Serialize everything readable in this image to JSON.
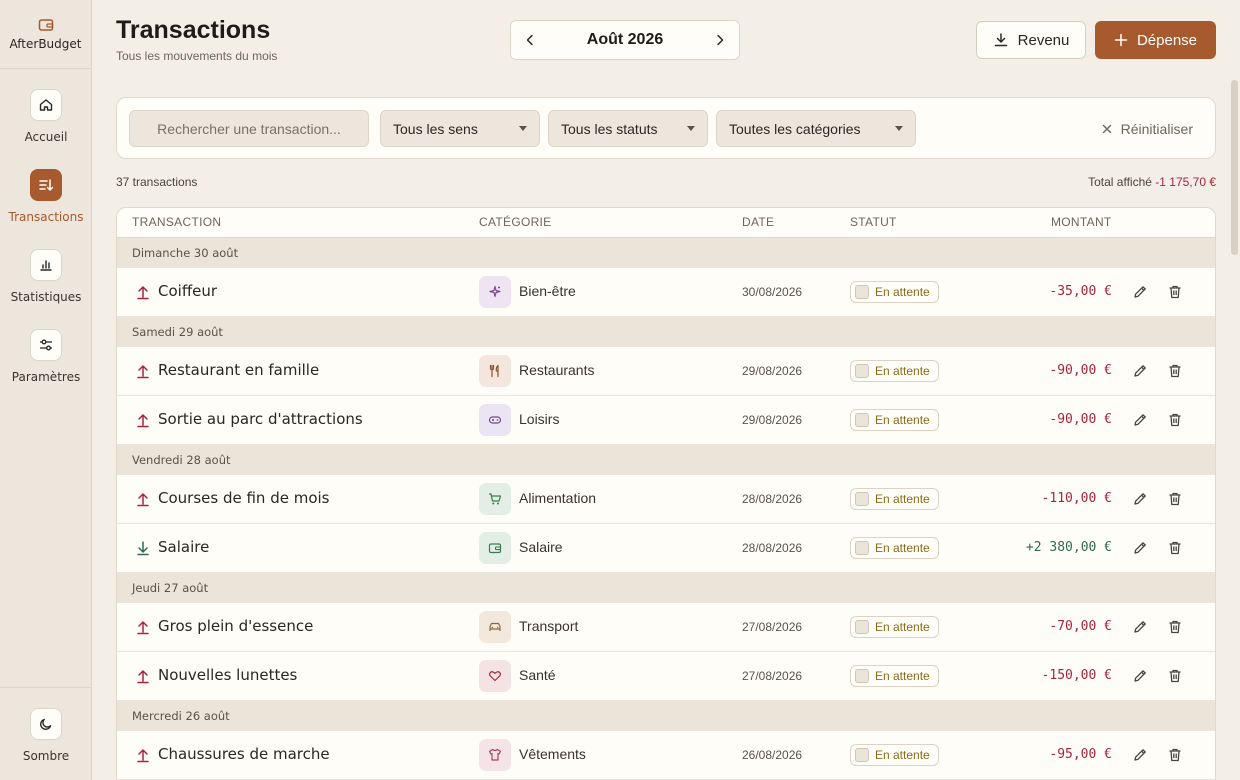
{
  "app": {
    "name": "AfterBudget"
  },
  "sidebar": {
    "items": [
      {
        "label": "Accueil",
        "icon": "home-icon"
      },
      {
        "label": "Transactions",
        "icon": "transactions-icon",
        "active": true
      },
      {
        "label": "Statistiques",
        "icon": "bar-chart-icon"
      },
      {
        "label": "Paramètres",
        "icon": "sliders-icon"
      }
    ],
    "theme_label": "Sombre"
  },
  "header": {
    "title": "Transactions",
    "subtitle": "Tous les mouvements du mois",
    "month": "Août 2026",
    "revenu_label": "Revenu",
    "depense_label": "Dépense"
  },
  "filters": {
    "search_placeholder": "Rechercher une transaction...",
    "sens": "Tous les sens",
    "statuts": "Tous les statuts",
    "categories": "Toutes les catégories",
    "reset": "Réinitialiser"
  },
  "summary": {
    "count": "37 transactions",
    "total_label": "Total affiché",
    "total_value": "-1 175,70 €"
  },
  "table": {
    "headers": {
      "transaction": "TRANSACTION",
      "category": "CATÉGORIE",
      "date": "DATE",
      "status": "STATUT",
      "amount": "MONTANT"
    },
    "groups": [
      {
        "label": "Dimanche 30 août",
        "rows": [
          {
            "name": "Coiffeur",
            "direction": "out",
            "category": "Bien-être",
            "cat_icon": "sparkles-icon",
            "date": "30/08/2026",
            "status": "En attente",
            "amount": "-35,00 €"
          }
        ]
      },
      {
        "label": "Samedi 29 août",
        "rows": [
          {
            "name": "Restaurant en famille",
            "direction": "out",
            "category": "Restaurants",
            "cat_icon": "fork-knife-icon",
            "date": "29/08/2026",
            "status": "En attente",
            "amount": "-90,00 €"
          },
          {
            "name": "Sortie au parc d'attractions",
            "direction": "out",
            "category": "Loisirs",
            "cat_icon": "gamepad-icon",
            "date": "29/08/2026",
            "status": "En attente",
            "amount": "-90,00 €"
          }
        ]
      },
      {
        "label": "Vendredi 28 août",
        "rows": [
          {
            "name": "Courses de fin de mois",
            "direction": "out",
            "category": "Alimentation",
            "cat_icon": "cart-icon",
            "date": "28/08/2026",
            "status": "En attente",
            "amount": "-110,00 €"
          },
          {
            "name": "Salaire",
            "direction": "in",
            "category": "Salaire",
            "cat_icon": "wallet-icon",
            "date": "28/08/2026",
            "status": "En attente",
            "amount": "+2 380,00 €"
          }
        ]
      },
      {
        "label": "Jeudi 27 août",
        "rows": [
          {
            "name": "Gros plein d'essence",
            "direction": "out",
            "category": "Transport",
            "cat_icon": "car-icon",
            "date": "27/08/2026",
            "status": "En attente",
            "amount": "-70,00 €"
          },
          {
            "name": "Nouvelles lunettes",
            "direction": "out",
            "category": "Santé",
            "cat_icon": "heart-icon",
            "date": "27/08/2026",
            "status": "En attente",
            "amount": "-150,00 €"
          }
        ]
      },
      {
        "label": "Mercredi 26 août",
        "rows": [
          {
            "name": "Chaussures de marche",
            "direction": "out",
            "category": "Vêtements",
            "cat_icon": "shirt-icon",
            "date": "26/08/2026",
            "status": "En attente",
            "amount": "-95,00 €"
          }
        ]
      }
    ]
  },
  "colors": {
    "accent": "#a75a2d",
    "negative": "#a5253c",
    "positive": "#2f6b4f",
    "pending": "#8a6a1c"
  }
}
